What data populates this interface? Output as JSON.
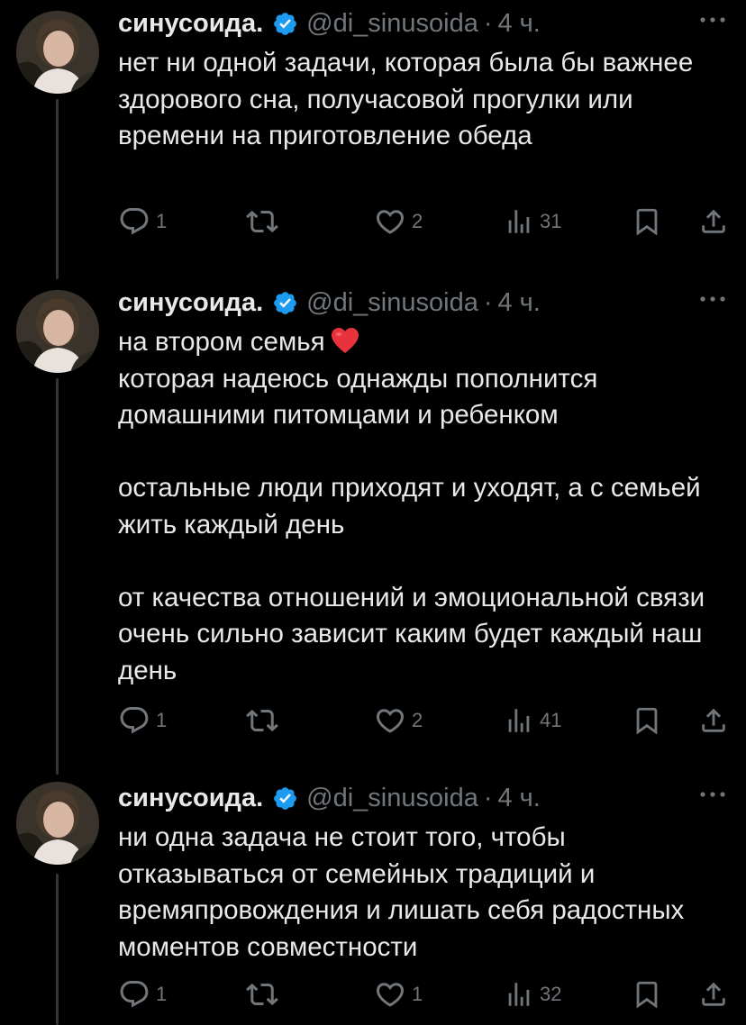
{
  "tweets": [
    {
      "author": "синусоида.",
      "handle": "@di_sinusoida",
      "separator": "·",
      "time": "4 ч.",
      "paragraphs": [
        "нет ни одной задачи, которая была бы важнее здорового сна, получасовой прогулки или времени на приготовление обеда"
      ],
      "replies": "1",
      "likes": "2",
      "views": "31"
    },
    {
      "author": "синусоида.",
      "handle": "@di_sinusoida",
      "separator": "·",
      "time": "4 ч.",
      "paragraphs": [
        "на втором семья",
        "которая надеюсь однажды пополнится домашними питомцами и ребенком",
        "",
        "остальные люди приходят и уходят, а с семьей жить каждый день",
        "",
        "от качества отношений и эмоциональной связи очень сильно зависит каким будет каждый наш день"
      ],
      "replies": "1",
      "likes": "2",
      "views": "41"
    },
    {
      "author": "синусоида.",
      "handle": "@di_sinusoida",
      "separator": "·",
      "time": "4 ч.",
      "paragraphs": [
        "ни одна задача не стоит того, чтобы отказываться от семейных традиций и времяпровождения и лишать себя радостных моментов совместности"
      ],
      "replies": "1",
      "likes": "1",
      "views": "32"
    }
  ],
  "icons": {
    "verified": "verified-badge-icon",
    "more": "more-dots-icon",
    "reply": "reply-icon",
    "retweet": "retweet-icon",
    "like": "heart-icon",
    "views": "views-icon",
    "bookmark": "bookmark-icon",
    "share": "share-icon",
    "emoji": "red-heart-emoji"
  },
  "colors": {
    "background": "#000000",
    "text": "#e7e9ea",
    "muted": "#71767b",
    "verified": "#1d9bf0",
    "thread_line": "#333639",
    "emoji": "#e8323c"
  }
}
